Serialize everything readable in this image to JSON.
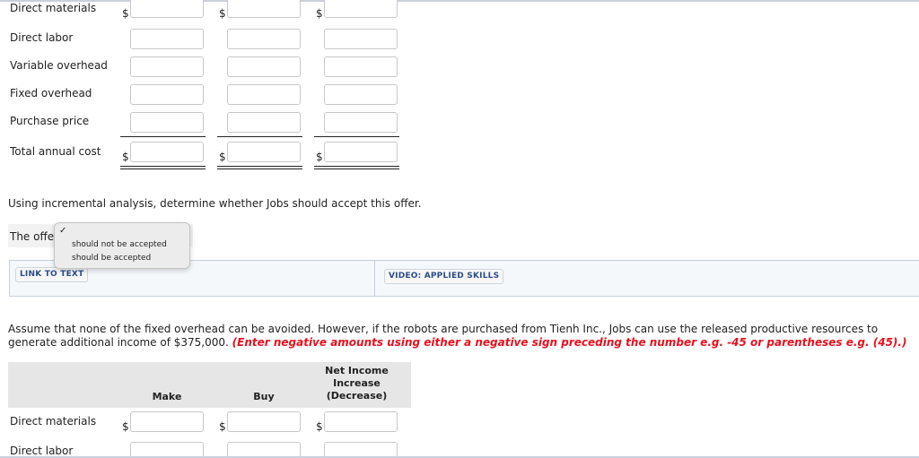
{
  "cost_table": {
    "rows": [
      {
        "label": "Direct materials",
        "dollar": true
      },
      {
        "label": "Direct labor",
        "dollar": false
      },
      {
        "label": "Variable overhead",
        "dollar": false
      },
      {
        "label": "Fixed overhead",
        "dollar": false
      },
      {
        "label": "Purchase price",
        "dollar": false
      },
      {
        "label": "Total annual cost",
        "dollar": true
      }
    ],
    "currency_symbol": "$",
    "values": [
      [
        "",
        "",
        ""
      ],
      [
        "",
        "",
        ""
      ],
      [
        "",
        "",
        ""
      ],
      [
        "",
        "",
        ""
      ],
      [
        "",
        "",
        ""
      ],
      [
        "",
        "",
        ""
      ]
    ]
  },
  "question": "Using incremental analysis, determine whether Jobs should accept this offer.",
  "offer": {
    "prefix": "The offe",
    "dropdown": {
      "selected_mark": "✓",
      "options": [
        "should not be accepted",
        "should be accepted"
      ]
    }
  },
  "resources": {
    "link_to_text": "LINK TO TEXT",
    "video_applied_skills": "VIDEO: APPLIED SKILLS"
  },
  "part2": {
    "paragraph": "Assume that none of the fixed overhead can be avoided. However, if the robots are purchased from Tienh Inc., Jobs can use the released productive resources to generate additional income of $375,000.",
    "instruction": "(Enter negative amounts using either a negative sign preceding the number e.g. -45 or parentheses e.g. (45).)",
    "columns": [
      "Make",
      "Buy",
      "Net Income\nIncrease\n(Decrease)"
    ],
    "column_lines": [
      [
        "Make"
      ],
      [
        "Buy"
      ],
      [
        "Net Income",
        "Increase",
        "(Decrease)"
      ]
    ],
    "rows": [
      {
        "label": "Direct materials",
        "dollar": true
      },
      {
        "label": "Direct labor",
        "dollar": false
      }
    ],
    "currency_symbol": "$"
  }
}
